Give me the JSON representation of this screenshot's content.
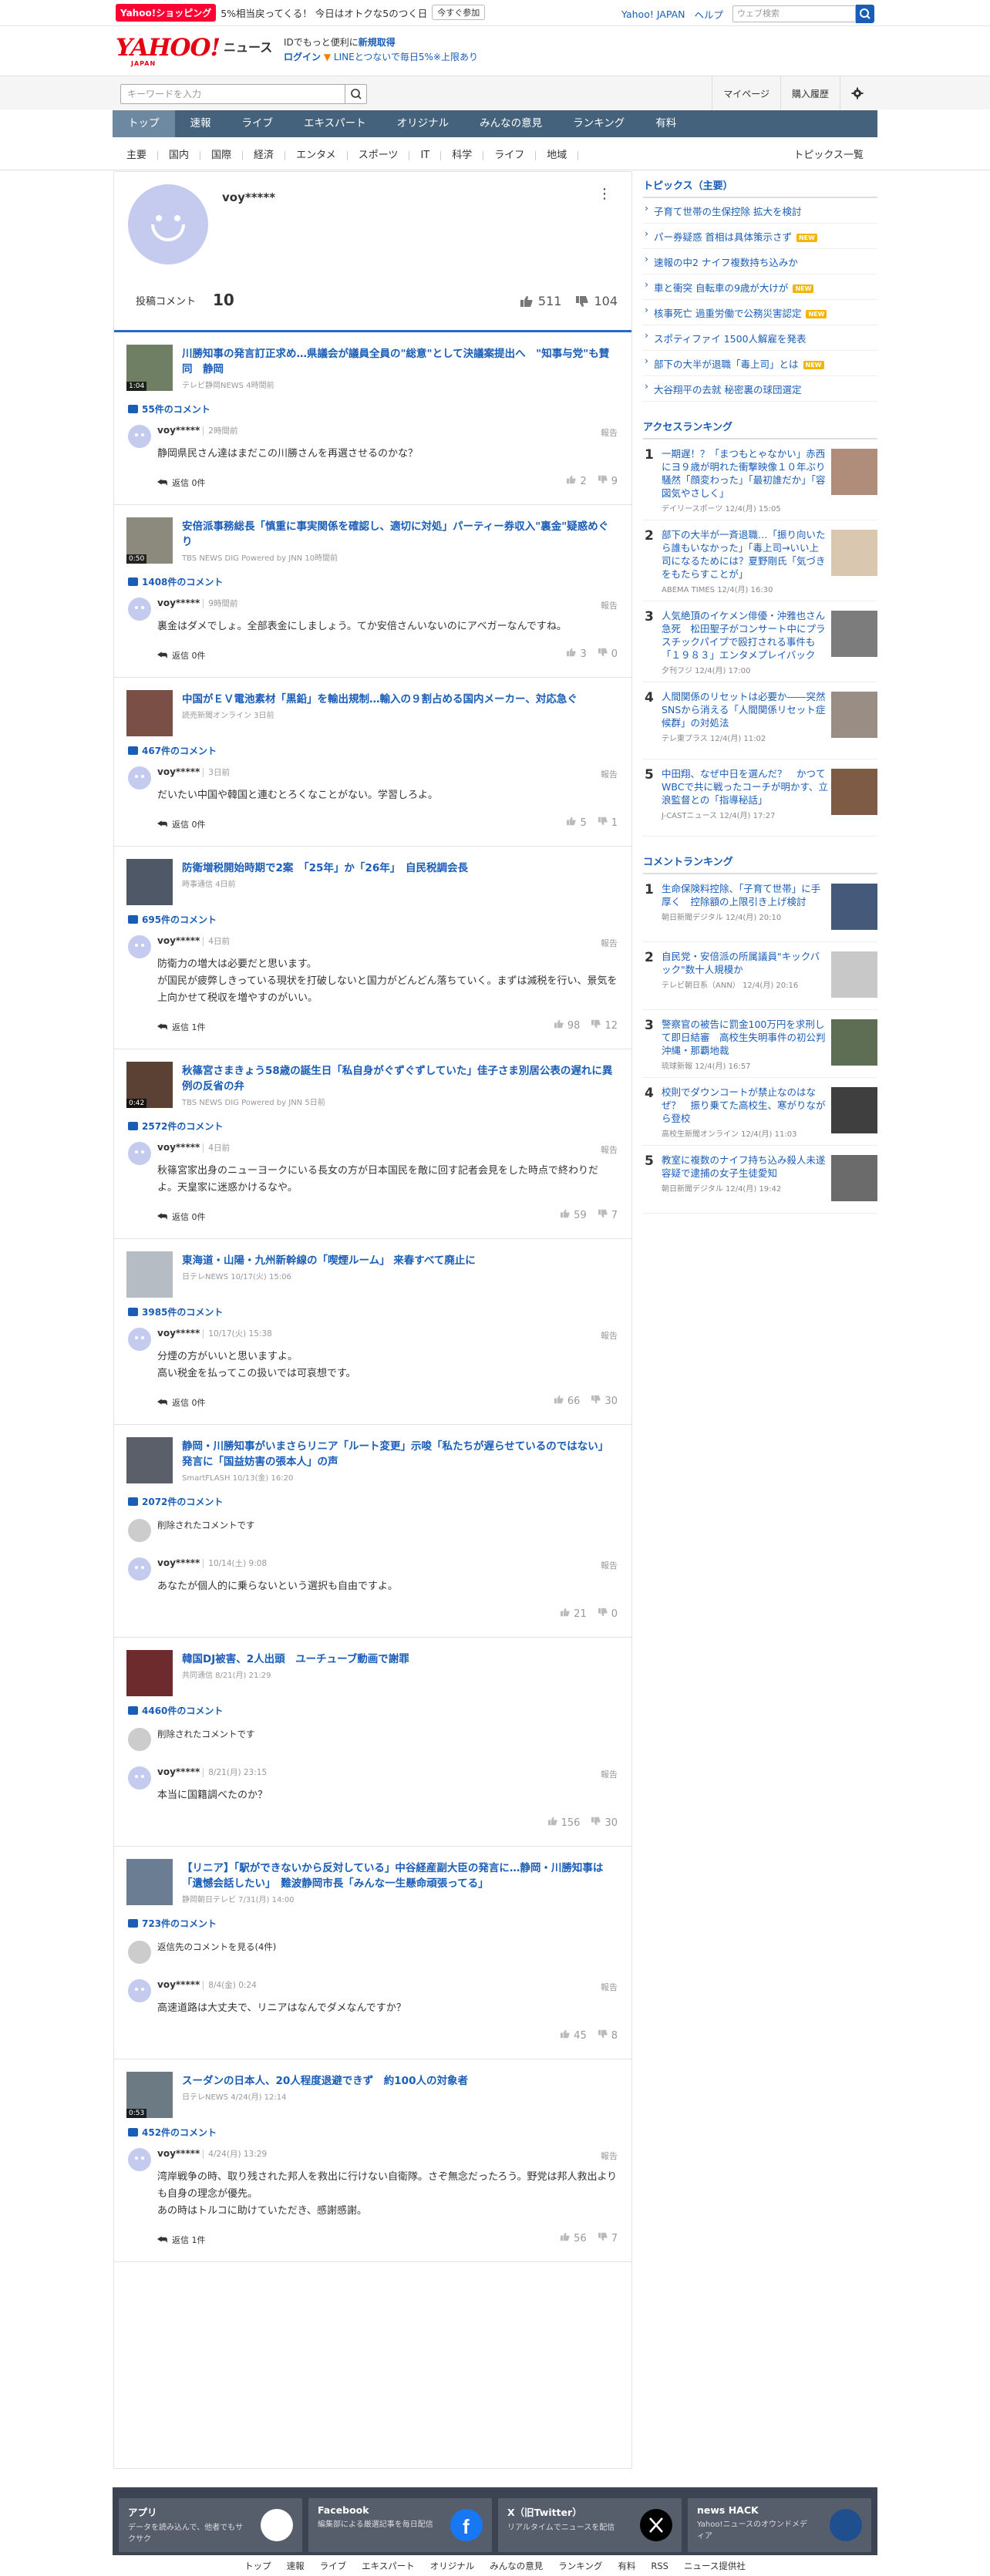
{
  "promo": {
    "tag": "Yahoo!ショッピング",
    "text": "5%相当戻ってくる！ 今日はオトクな5のつく日",
    "button": "今すぐ参加"
  },
  "top_links": {
    "yahoo_japan": "Yahoo! JAPAN",
    "help": "ヘルプ",
    "search_placeholder": "ウェブ検索"
  },
  "header": {
    "logo": "YAHOO!",
    "logo_sub": "JAPAN",
    "news": "ニュース",
    "id_line1_a": "IDでもっと便利に",
    "id_line1_b": "新規取得",
    "id_line2_a": "ログイン",
    "id_line2_b": "LINEとつないで毎日5%※上限あり"
  },
  "search": {
    "placeholder": "キーワードを入力",
    "mypage": "マイページ",
    "history": "購入履歴"
  },
  "gnav": [
    "トップ",
    "速報",
    "ライブ",
    "エキスパート",
    "オリジナル",
    "みんなの意見",
    "ランキング",
    "有料"
  ],
  "snav": [
    "主要",
    "国内",
    "国際",
    "経済",
    "エンタメ",
    "スポーツ",
    "IT",
    "科学",
    "ライフ",
    "地域"
  ],
  "snav_list": "トピックス一覧",
  "profile": {
    "name": "voy*****",
    "menu": "⋮",
    "stat_label": "投稿コメント",
    "stat_value": "10",
    "likes": "511",
    "dislikes": "104"
  },
  "items": [
    {
      "title": "川勝知事の発言訂正求め…県議会が議員全員の\"総意\"として決議案提出へ　\"知事与党\"も賛同　静岡",
      "source": "テレビ静岡NEWS 4時間前",
      "time": "1:04",
      "count": "55件のコメント",
      "user": "voy*****",
      "date": "2時間前",
      "text": "静岡県民さん達はまだこの川勝さんを再選させるのかな？",
      "reply": "返信 0件",
      "up": "2",
      "down": "9",
      "deleted": "",
      "color": "#6e7f63"
    },
    {
      "title": "安倍派事務総長「慎重に事実関係を確認し、適切に対処」パーティー券収入\"裏金\"疑惑めぐり",
      "source": "TBS NEWS DIG Powered by JNN 10時間前",
      "time": "0:50",
      "count": "1408件のコメント",
      "user": "voy*****",
      "date": "9時間前",
      "text": "裏金はダメでしょ。全部表金にしましょう。てか安倍さんいないのにアベガーなんですね。",
      "reply": "返信 0件",
      "up": "3",
      "down": "0",
      "deleted": "",
      "color": "#8c8a7c"
    },
    {
      "title": "中国がＥＶ電池素材「黒鉛」を輸出規制…輸入の９割占める国内メーカー、対応急ぐ",
      "source": "読売新聞オンライン 3日前",
      "time": "",
      "count": "467件のコメント",
      "user": "voy*****",
      "date": "3日前",
      "text": "だいたい中国や韓国と連むとろくなことがない。学習しろよ。",
      "reply": "返信 0件",
      "up": "5",
      "down": "1",
      "deleted": "",
      "color": "#7a5046"
    },
    {
      "title": "防衛増税開始時期で2案　「25年」か「26年」　自民税調会長",
      "source": "時事通信 4日前",
      "time": "",
      "count": "695件のコメント",
      "user": "voy*****",
      "date": "4日前",
      "text": "防衛力の増大は必要だと思います。\nが国民が疲弊しきっている現状を打破しないと国力がどんどん落ちていく。まずは減税を行い、景気を上向かせて税収を増やすのがいい。",
      "reply": "返信 1件",
      "up": "98",
      "down": "12",
      "deleted": "",
      "color": "#4f5866"
    },
    {
      "title": "秋篠宮さまきょう58歳の誕生日「私自身がぐずぐずしていた」佳子さま別居公表の遅れに異例の反省の弁",
      "source": "TBS NEWS DIG Powered by JNN 5日前",
      "time": "0:42",
      "count": "2572件のコメント",
      "user": "voy*****",
      "date": "4日前",
      "text": "秋篠宮家出身のニューヨークにいる長女の方が日本国民を敵に回す記者会見をした時点で終わりだよ。天皇家に迷惑かけるなや。",
      "reply": "返信 0件",
      "up": "59",
      "down": "7",
      "deleted": "",
      "color": "#5b4034"
    },
    {
      "title": "東海道・山陽・九州新幹線の「喫煙ルーム」 来春すべて廃止に",
      "source": "日テレNEWS 10/17(火) 15:06",
      "time": "",
      "count": "3985件のコメント",
      "user": "voy*****",
      "date": "10/17(火) 15:38",
      "text": "分煙の方がいいと思いますよ。\n高い税金を払ってこの扱いでは可哀想です。",
      "reply": "返信 0件",
      "up": "66",
      "down": "30",
      "deleted": "",
      "color": "#b5bcc4"
    },
    {
      "title": "静岡・川勝知事がいまさらリニア「ルート変更」示唆「私たちが遅らせているのではない」発言に「国益妨害の張本人」の声",
      "source": "SmartFLASH 10/13(金) 16:20",
      "time": "",
      "count": "2072件のコメント",
      "user": "voy*****",
      "date": "10/14(土) 9:08",
      "text": "あなたが個人的に乗らないという選択も自由ですよ。",
      "reply": "",
      "up": "21",
      "down": "0",
      "deleted": "削除されたコメントです",
      "color": "#5a5f6a"
    },
    {
      "title": "韓国DJ被害、2人出頭　ユーチューブ動画で謝罪",
      "source": "共同通信 8/21(月) 21:29",
      "time": "",
      "count": "4460件のコメント",
      "user": "voy*****",
      "date": "8/21(月) 23:15",
      "text": "本当に国籍調べたのか？",
      "reply": "",
      "up": "156",
      "down": "30",
      "deleted": "削除されたコメントです",
      "color": "#6d2b2e"
    },
    {
      "title": "【リニア】「駅ができないから反対している」中谷経産副大臣の発言に…静岡・川勝知事は「遺憾会話したい」　難波静岡市長「みんな一生懸命頑張ってる」",
      "source": "静岡朝日テレビ 7/31(月) 14:00",
      "time": "",
      "count": "723件のコメント",
      "user": "voy*****",
      "date": "8/4(金) 0:24",
      "text": "高速道路は大丈夫で、リニアはなんでダメなんですか？",
      "reply": "",
      "up": "45",
      "down": "8",
      "deleted": "返信先のコメントを見る(4件)",
      "color": "#6a7d93"
    },
    {
      "title": "スーダンの日本人、20人程度退避できず　約100人の対象者",
      "source": "日テレNEWS 4/24(月) 12:14",
      "time": "0:53",
      "count": "452件のコメント",
      "user": "voy*****",
      "date": "4/24(月) 13:29",
      "text": "湾岸戦争の時、取り残された邦人を救出に行けない自衛隊。さぞ無念だったろう。野党は邦人救出よりも自身の理念が優先。\nあの時はトルコに助けていただき、感謝感謝。",
      "reply": "返信 1件",
      "up": "56",
      "down": "7",
      "deleted": "",
      "color": "#6c7a83"
    }
  ],
  "report_label": "報告",
  "sidebar": {
    "topics_title": "トピックス（主要）",
    "topics": [
      {
        "t": "子育て世帯の生保控除 拡大を検討",
        "new": ""
      },
      {
        "t": "パー券疑惑 首相は具体策示さず",
        "new": "NEW"
      },
      {
        "t": "速報の中2 ナイフ複数持ち込みか",
        "new": ""
      },
      {
        "t": "車と衝突 自転車の9歳が大けが",
        "new": "NEW"
      },
      {
        "t": "核事死亡 過重労働で公務災害認定",
        "new": "NEW"
      },
      {
        "t": "スポティファイ 1500人解雇を発表",
        "new": ""
      },
      {
        "t": "部下の大半が退職「毒上司」とは",
        "new": "NEW"
      },
      {
        "t": "大谷翔平の去就 秘密裏の球団選定",
        "new": ""
      }
    ],
    "access_title": "アクセスランキング",
    "access": [
      {
        "n": "1",
        "t": "一期遅！？「まつもとゃなかい」赤西にヨ９歳が明れた衝撃映像１０年ぶり騒然「顔変わった」「最初誰だか」「容図気やさしく」",
        "s": "デイリースポーツ 12/4(月) 15:05"
      },
      {
        "n": "2",
        "t": "部下の大半が一斉退職…「振り向いたら誰もいなかった」「毒上司→いい上司になるためには？夏野剛氏「気づきをもたらすことが」",
        "s": "ABEMA TIMES 12/4(月) 16:30"
      },
      {
        "n": "3",
        "t": "人気絶頂のイケメン俳優・沖雅也さん急死　松田聖子がコンサート中にプラスチックパイプで殴打される事件も　「１９８３」エンタメプレイバック",
        "s": "夕刊フジ 12/4(月) 17:00"
      },
      {
        "n": "4",
        "t": "人間関係のリセットは必要か――突然SNSから消える「人間関係リセット症候群」の対処法",
        "s": "テレ東プラス 12/4(月) 11:02"
      },
      {
        "n": "5",
        "t": "中田翔、なぜ中日を選んだ？　かつてWBCで共に戦ったコーチが明かす、立浪監督との「指導秘話」",
        "s": "J-CASTニュース 12/4(月) 17:27"
      }
    ],
    "comment_title": "コメントランキング",
    "comments": [
      {
        "n": "1",
        "t": "生命保険料控除、「子育て世帯」に手厚く　控除額の上限引き上げ検討",
        "s": "朝日新聞デジタル 12/4(月) 20:10"
      },
      {
        "n": "2",
        "t": "自民党・安倍派の所属議員\"キックバック\"数十人規模か",
        "s": "テレビ朝日系（ANN） 12/4(月) 20:16"
      },
      {
        "n": "3",
        "t": "警察官の被告に罰金100万円を求刑して即日結審　高校生失明事件の初公判　沖縄・那覇地裁",
        "s": "琉球新報 12/4(月) 16:57"
      },
      {
        "n": "4",
        "t": "校則でダウンコートが禁止なのはなぜ？　振り乗てた高校生、寒がりながら登校",
        "s": "高校生新聞オンライン 12/4(月) 11:03"
      },
      {
        "n": "5",
        "t": "教室に複数のナイフ持ち込み殺人未遂容疑で逮捕の女子生徒愛知",
        "s": "朝日新聞デジタル 12/4(月) 19:42"
      }
    ]
  },
  "footer": {
    "cards": [
      {
        "t": "アプリ",
        "d": "データを読み込んで、他者でもサクサク",
        "icon_color": "#ffffff"
      },
      {
        "t": "Facebook",
        "d": "編集部による厳選記事を毎日配信",
        "icon_color": "#1877f2"
      },
      {
        "t": "X（旧Twitter）",
        "d": "リアルタイムでニュースを配信",
        "icon_color": "#000000"
      },
      {
        "t": "news HACK",
        "d": "Yahoo!ニュースのオウンドメディア",
        "icon_color": "#1f4f8f"
      }
    ],
    "links": [
      "トップ",
      "速報",
      "ライブ",
      "エキスパート",
      "オリジナル",
      "みんなの意見",
      "ランキング",
      "有料",
      "RSS",
      "ニュース提供社"
    ]
  }
}
